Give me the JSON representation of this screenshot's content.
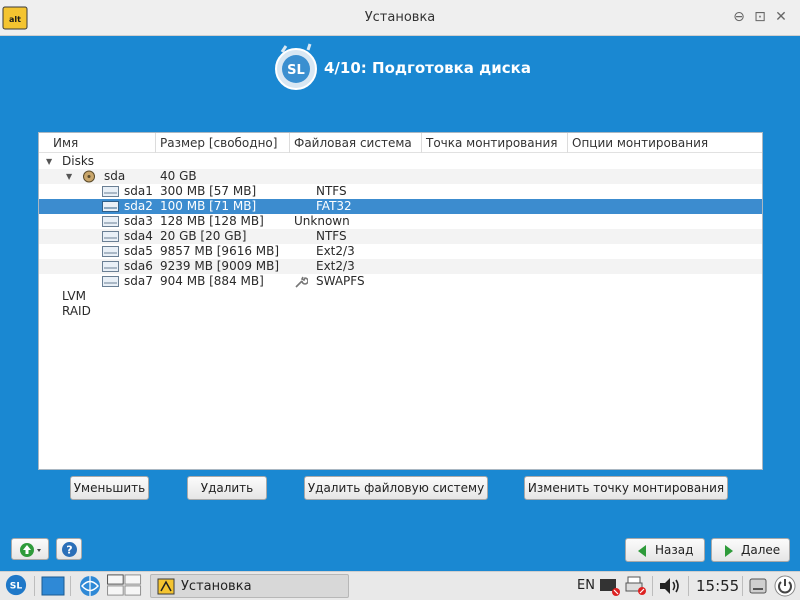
{
  "window": {
    "title": "Установка",
    "logo_text": "alt",
    "min_icon": "⊖",
    "max_icon": "⊡",
    "close_icon": "✕"
  },
  "step": {
    "title": "4/10: Подготовка диска",
    "logo_text": "SL"
  },
  "table": {
    "columns": [
      "Имя",
      "Размер [свободно]",
      "Файловая система",
      "Точка монтирования",
      "Опции монтирования"
    ],
    "tree": {
      "disks_label": "Disks",
      "disk": {
        "name": "sda",
        "size": "40 GB"
      },
      "partitions": [
        {
          "name": "sda1",
          "size": "300 MB [57 MB]",
          "fs": "NTFS"
        },
        {
          "name": "sda2",
          "size": "100 MB [71 MB]",
          "fs": "FAT32"
        },
        {
          "name": "sda3",
          "size": "128 MB [128 MB]",
          "fs": "Unknown"
        },
        {
          "name": "sda4",
          "size": "20 GB [20 GB]",
          "fs": "NTFS"
        },
        {
          "name": "sda5",
          "size": "9857 MB [9616 MB]",
          "fs": "Ext2/3"
        },
        {
          "name": "sda6",
          "size": "9239 MB [9009 MB]",
          "fs": "Ext2/3"
        },
        {
          "name": "sda7",
          "size": "904 MB [884 MB]",
          "fs": "SWAPFS"
        }
      ],
      "lvm_label": "LVM",
      "raid_label": "RAID"
    },
    "selected_partition": "sda2"
  },
  "actions": {
    "shrink": "Уменьшить",
    "delete": "Удалить",
    "delete_fs": "Удалить файловую систему",
    "change_mount": "Изменить точку монтирования"
  },
  "nav": {
    "back": "Назад",
    "next": "Далее",
    "help_icon": "?"
  },
  "taskbar": {
    "start_logo": "SL",
    "task_label": "Установка",
    "lang": "EN",
    "clock": "15:55"
  },
  "colors": {
    "background": "#1a88d2",
    "selection": "#3c8ccf",
    "accent_green": "#2e9b3a"
  }
}
